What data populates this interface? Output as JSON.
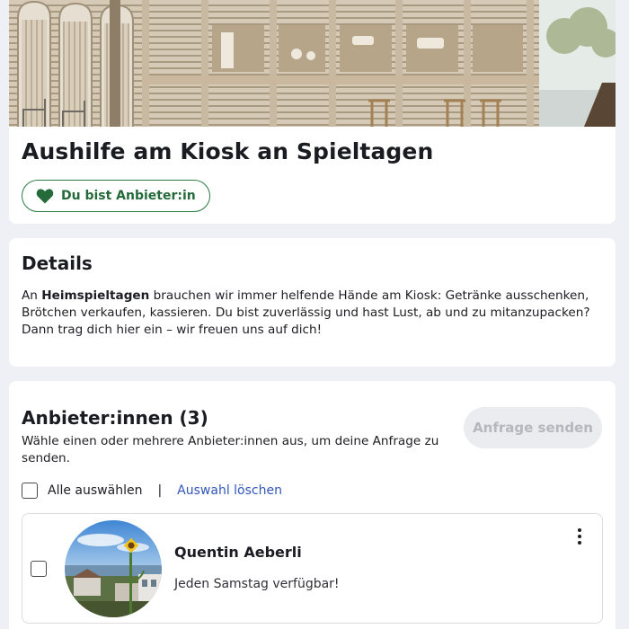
{
  "job": {
    "title": "Aushilfe am Kiosk an Spieltagen",
    "provider_badge": "Du bist Anbieter:in",
    "provider_badge_icon": "heart-icon",
    "badge_color": "#2a7a43"
  },
  "details": {
    "heading": "Details",
    "body_prefix": "An ",
    "body_bold": "Heimspieltagen",
    "body_rest": " brauchen wir immer helfende Hände am Kiosk: Getränke ausschenken, Brötchen verkaufen, kassieren. Du bist zuverlässig und hast Lust, ab und zu mitanzupacken? Dann trag dich hier ein – wir freuen uns auf dich!"
  },
  "providers": {
    "heading": "Anbieter:innen (3)",
    "send_button": "Anfrage senden",
    "hint": "Wähle einen oder mehrere Anbieter:innen aus, um deine Anfrage zu senden.",
    "select_all": "Alle auswählen",
    "separator": "|",
    "clear_selection": "Auswahl löschen",
    "link_color": "#3156b8",
    "items": [
      {
        "name": "Quentin Aeberli",
        "note": "Jeden Samstag verfügbar!",
        "checked": false,
        "menu_icon": "more-vertical-icon"
      }
    ]
  }
}
